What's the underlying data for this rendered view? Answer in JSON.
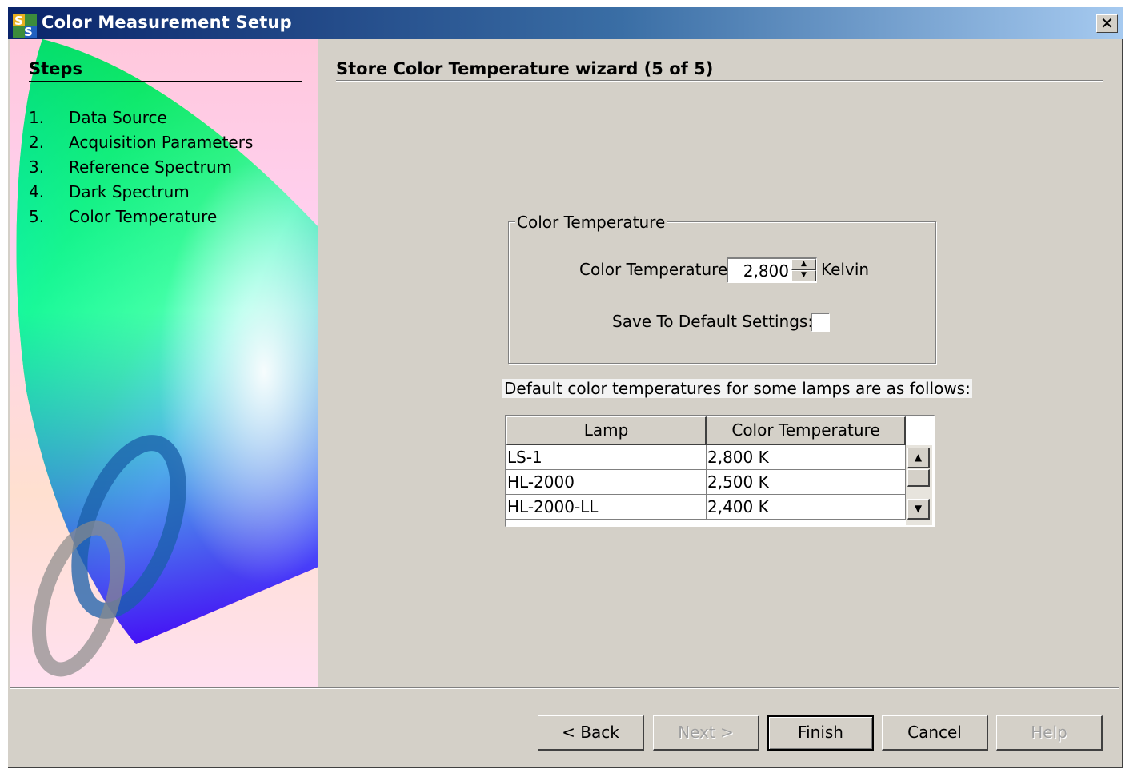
{
  "window": {
    "title": "Color Measurement Setup",
    "close_glyph": "✕",
    "icon": "ss-app-icon"
  },
  "sidebar": {
    "title": "Steps",
    "steps": [
      {
        "num": "1.",
        "label": "Data Source"
      },
      {
        "num": "2.",
        "label": "Acquisition Parameters"
      },
      {
        "num": "3.",
        "label": "Reference Spectrum"
      },
      {
        "num": "4.",
        "label": "Dark Spectrum"
      },
      {
        "num": "5.",
        "label": "Color Temperature"
      }
    ]
  },
  "main": {
    "title": "Store Color Temperature wizard (5 of 5)",
    "group": {
      "legend": "Color Temperature",
      "temp_label": "Color Temperature:",
      "temp_value": "2,800",
      "temp_unit": "Kelvin",
      "save_label": "Save To Default Settings:",
      "save_checked": false
    },
    "note": "Default color temperatures for some lamps are as follows:",
    "table": {
      "columns": [
        "Lamp",
        "Color Temperature"
      ],
      "rows": [
        [
          "LS-1",
          "2,800 K"
        ],
        [
          "HL-2000",
          "2,500 K"
        ],
        [
          "HL-2000-LL",
          "2,400 K"
        ]
      ]
    }
  },
  "buttons": {
    "back": "< Back",
    "next": "Next >",
    "finish": "Finish",
    "cancel": "Cancel",
    "help": "Help"
  }
}
